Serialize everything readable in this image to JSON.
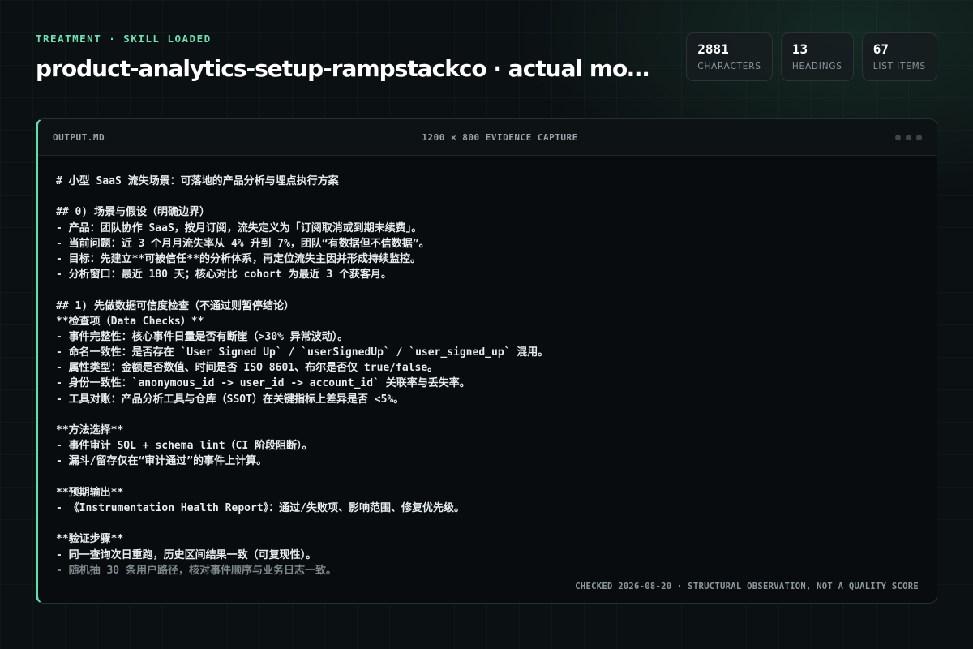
{
  "header": {
    "eyebrow": "TREATMENT · SKILL LOADED",
    "title": "product-analytics-setup-rampstackco · actual model ar…"
  },
  "stats": [
    {
      "value": "2881",
      "label": "CHARACTERS"
    },
    {
      "value": "13",
      "label": "HEADINGS"
    },
    {
      "value": "67",
      "label": "LIST ITEMS"
    }
  ],
  "panel": {
    "file_name": "OUTPUT.MD",
    "capture_label": "1200 × 800 EVIDENCE CAPTURE",
    "footer_note": "CHECKED 2026-08-20 · STRUCTURAL OBSERVATION, NOT A QUALITY SCORE",
    "lines": [
      "# 小型 SaaS 流失场景：可落地的产品分析与埋点执行方案",
      "",
      "## 0) 场景与假设（明确边界）",
      "- 产品：团队协作 SaaS，按月订阅，流失定义为「订阅取消或到期未续费」。",
      "- 当前问题：近 3 个月月流失率从 4% 升到 7%，团队“有数据但不信数据”。",
      "- 目标：先建立**可被信任**的分析体系，再定位流失主因并形成持续监控。",
      "- 分析窗口：最近 180 天；核心对比 cohort 为最近 3 个获客月。",
      "",
      "## 1) 先做数据可信度检查（不通过则暂停结论）",
      "**检查项（Data Checks）**",
      "- 事件完整性：核心事件日量是否有断崖（>30% 异常波动）。",
      "- 命名一致性：是否存在 `User Signed Up` / `userSignedUp` / `user_signed_up` 混用。",
      "- 属性类型：金额是否数值、时间是否 ISO 8601、布尔是否仅 true/false。",
      "- 身份一致性：`anonymous_id -> user_id -> account_id` 关联率与丢失率。",
      "- 工具对账：产品分析工具与仓库（SSOT）在关键指标上差异是否 <5%。",
      "",
      "**方法选择**",
      "- 事件审计 SQL + schema lint（CI 阶段阻断）。",
      "- 漏斗/留存仅在“审计通过”的事件上计算。",
      "",
      "**预期输出**",
      "- 《Instrumentation Health Report》：通过/失败项、影响范围、修复优先级。",
      "",
      "**验证步骤**",
      "- 同一查询次日重跑，历史区间结果一致（可复现性）。",
      "- 随机抽 30 条用户路径，核对事件顺序与业务日志一致。"
    ]
  }
}
